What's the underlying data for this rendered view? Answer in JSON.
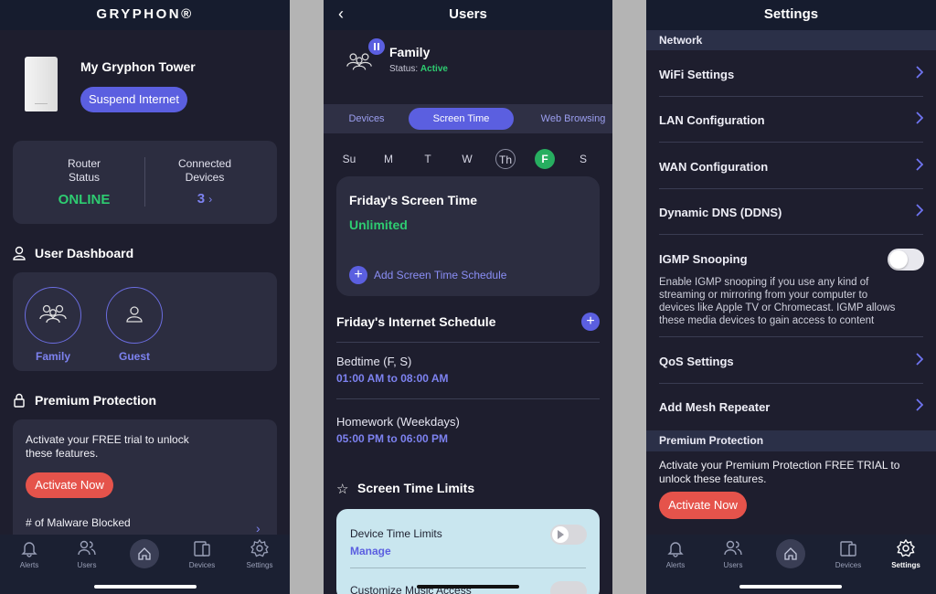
{
  "screen1": {
    "logo": "GRYPHON®",
    "device_name": "My Gryphon Tower",
    "suspend_label": "Suspend Internet",
    "router_status_label_1": "Router",
    "router_status_label_2": "Status",
    "router_status_value": "ONLINE",
    "connected_label_1": "Connected",
    "connected_label_2": "Devices",
    "connected_value": "3",
    "dashboard_title": "User Dashboard",
    "users": [
      {
        "label": "Family",
        "icon": "group-icon"
      },
      {
        "label": "Guest",
        "icon": "person-icon"
      }
    ],
    "premium_title": "Premium Protection",
    "premium_text_1": "Activate your FREE trial to unlock",
    "premium_text_2": "these features.",
    "activate_label": "Activate Now",
    "malware_label": "# of Malware Blocked"
  },
  "screen2": {
    "title": "Users",
    "profile_name": "Family",
    "status_label": "Status:",
    "status_value": "Active",
    "segments": [
      "Devices",
      "Screen Time",
      "Web Browsing"
    ],
    "days": [
      "Su",
      "M",
      "T",
      "W",
      "Th",
      "F",
      "S"
    ],
    "screen_time_title": "Friday's Screen Time",
    "screen_time_value": "Unlimited",
    "add_schedule_label": "Add Screen Time Schedule",
    "internet_schedule_title": "Friday's Internet Schedule",
    "schedules": [
      {
        "name": "Bedtime (F, S)",
        "time": "01:00 AM to 08:00 AM"
      },
      {
        "name": "Homework (Weekdays)",
        "time": "05:00 PM to 06:00 PM"
      }
    ],
    "limits_title": "Screen Time Limits",
    "device_limits_label": "Device Time Limits",
    "manage_label": "Manage",
    "music_label": "Customize Music Access"
  },
  "screen3": {
    "title": "Settings",
    "network_header": "Network",
    "rows_a": [
      "WiFi Settings",
      "LAN Configuration",
      "WAN Configuration",
      "Dynamic DNS (DDNS)"
    ],
    "igmp_label": "IGMP Snooping",
    "igmp_desc_1": "Enable IGMP snooping if you use any kind of",
    "igmp_desc_2": "streaming or mirroring from your computer to",
    "igmp_desc_3": "devices like Apple TV or Chromecast.  IGMP allows",
    "igmp_desc_4": "these media devices to gain access to content",
    "rows_b": [
      "QoS Settings",
      "Add Mesh Repeater"
    ],
    "premium_header": "Premium Protection",
    "premium_text_1": "Activate your Premium Protection FREE TRIAL to",
    "premium_text_2": "unlock these features.",
    "activate_label": "Activate Now"
  },
  "tabs": [
    "Alerts",
    "Users",
    "Home",
    "Devices",
    "Settings"
  ],
  "colors": {
    "accent": "#5b5fe0",
    "online": "#2ecc71",
    "danger": "#e5534b",
    "background": "#1e1e2e"
  }
}
